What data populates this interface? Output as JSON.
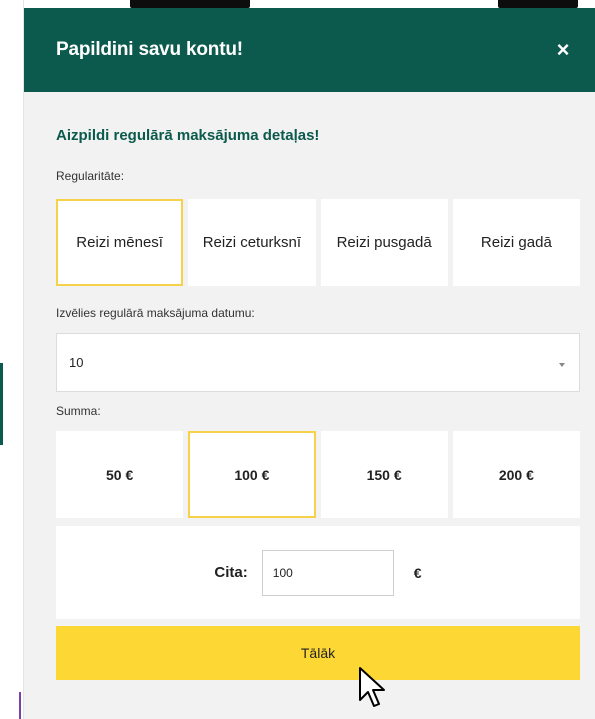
{
  "modal": {
    "title": "Papildini savu kontu!",
    "close_icon": "×",
    "subtitle": "Aizpildi regulārā maksājuma detaļas!"
  },
  "regularity": {
    "label": "Regularitāte:",
    "options": [
      "Reizi mēnesī",
      "Reizi ceturksnī",
      "Reizi pusgadā",
      "Reizi gadā"
    ],
    "selected": "Reizi mēnesī"
  },
  "date": {
    "label": "Izvēlies regulārā maksājuma datumu:",
    "value": "10",
    "icon": "chevron-down-icon"
  },
  "sum": {
    "label": "Summa:",
    "options": [
      "50 €",
      "100 €",
      "150 €",
      "200 €"
    ],
    "selected": "100 €",
    "other_label": "Cita:",
    "other_value": "100",
    "currency": "€"
  },
  "next_button": "Tālāk",
  "colors": {
    "header": "#0b5a4d",
    "accent": "#fdd835",
    "selected_border": "#f5d24a",
    "subtitle": "#0b5a4d"
  }
}
